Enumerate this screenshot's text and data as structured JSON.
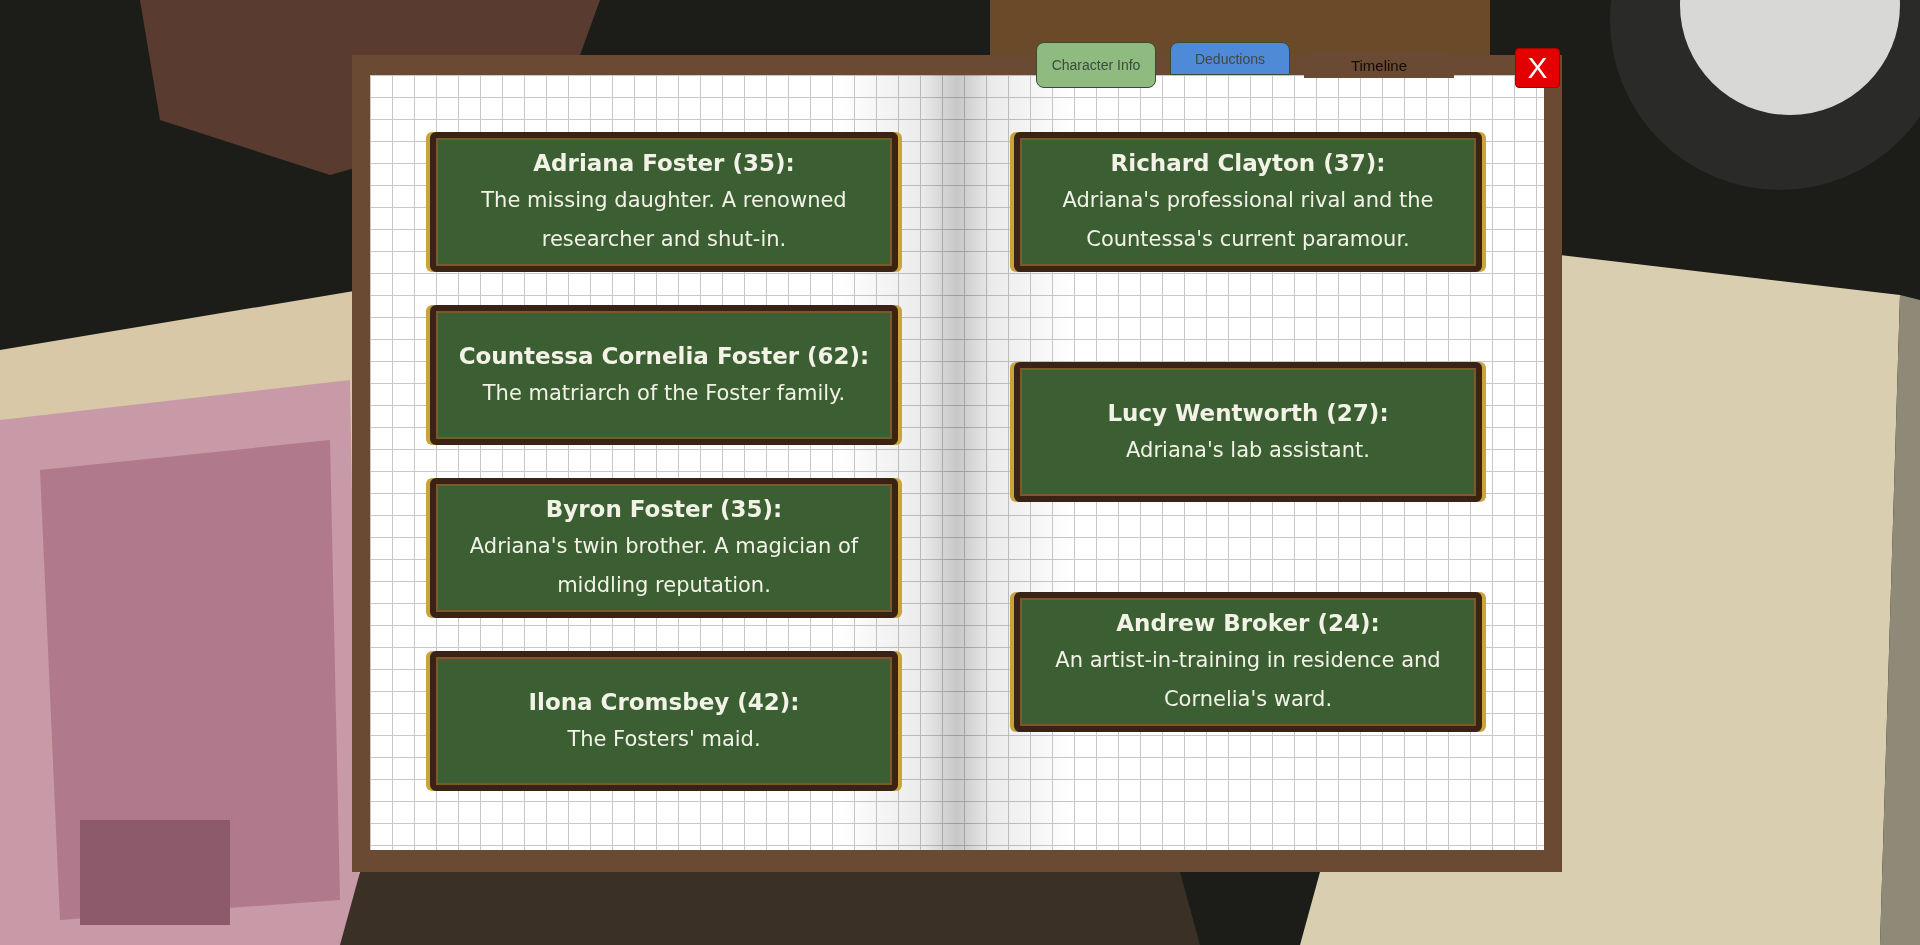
{
  "tabs": [
    {
      "label": "Character Info",
      "selected": true,
      "disabled": false,
      "color": "#8fba80"
    },
    {
      "label": "Deductions",
      "selected": false,
      "disabled": false,
      "color": "#4f8ad8"
    },
    {
      "label": "Timeline",
      "selected": false,
      "disabled": true,
      "color": "#6b4a33"
    }
  ],
  "close_button": {
    "label": "X"
  },
  "pages": [
    {
      "cards": [
        {
          "name": "Adriana Foster (35):",
          "description": "The missing daughter. A renowned researcher and shut-in."
        },
        {
          "name": "Countessa Cornelia Foster (62):",
          "description": "The matriarch of the Foster family."
        },
        {
          "name": "Byron Foster (35):",
          "description": "Adriana's twin brother. A magician of middling reputation."
        },
        {
          "name": "Ilona Cromsbey (42):",
          "description": "The Fosters' maid."
        }
      ]
    },
    {
      "cards": [
        {
          "name": "Richard Clayton (37):",
          "description": "Adriana's professional rival and the Countessa's current paramour."
        },
        {
          "name": "Lucy Wentworth (27):",
          "description": "Adriana's lab assistant."
        },
        {
          "name": "Andrew Broker (24):",
          "description": "An artist-in-training in residence and Cornelia's ward."
        }
      ]
    }
  ]
}
